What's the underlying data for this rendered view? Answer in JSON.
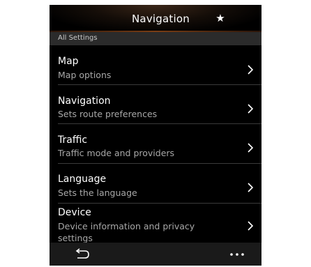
{
  "header": {
    "title": "Navigation",
    "favorite_icon": "star-icon"
  },
  "section": {
    "label": "All Settings"
  },
  "items": [
    {
      "title": "Map",
      "subtitle": "Map options"
    },
    {
      "title": "Navigation",
      "subtitle": "Sets route preferences"
    },
    {
      "title": "Traffic",
      "subtitle": "Traffic mode and providers"
    },
    {
      "title": "Language",
      "subtitle": "Sets the language"
    },
    {
      "title": "Device",
      "subtitle_line1": "Device information and privacy",
      "subtitle_line2": "settings"
    }
  ],
  "bottom_bar": {
    "back_icon": "back-arrow-icon",
    "more_icon": "more-options-icon"
  },
  "colors": {
    "background": "#000000",
    "accent": "#7a3d14",
    "section_bar": "#2b2b2b",
    "bottom_bar": "#1a1a1a",
    "subtitle": "#a8a8a8"
  }
}
